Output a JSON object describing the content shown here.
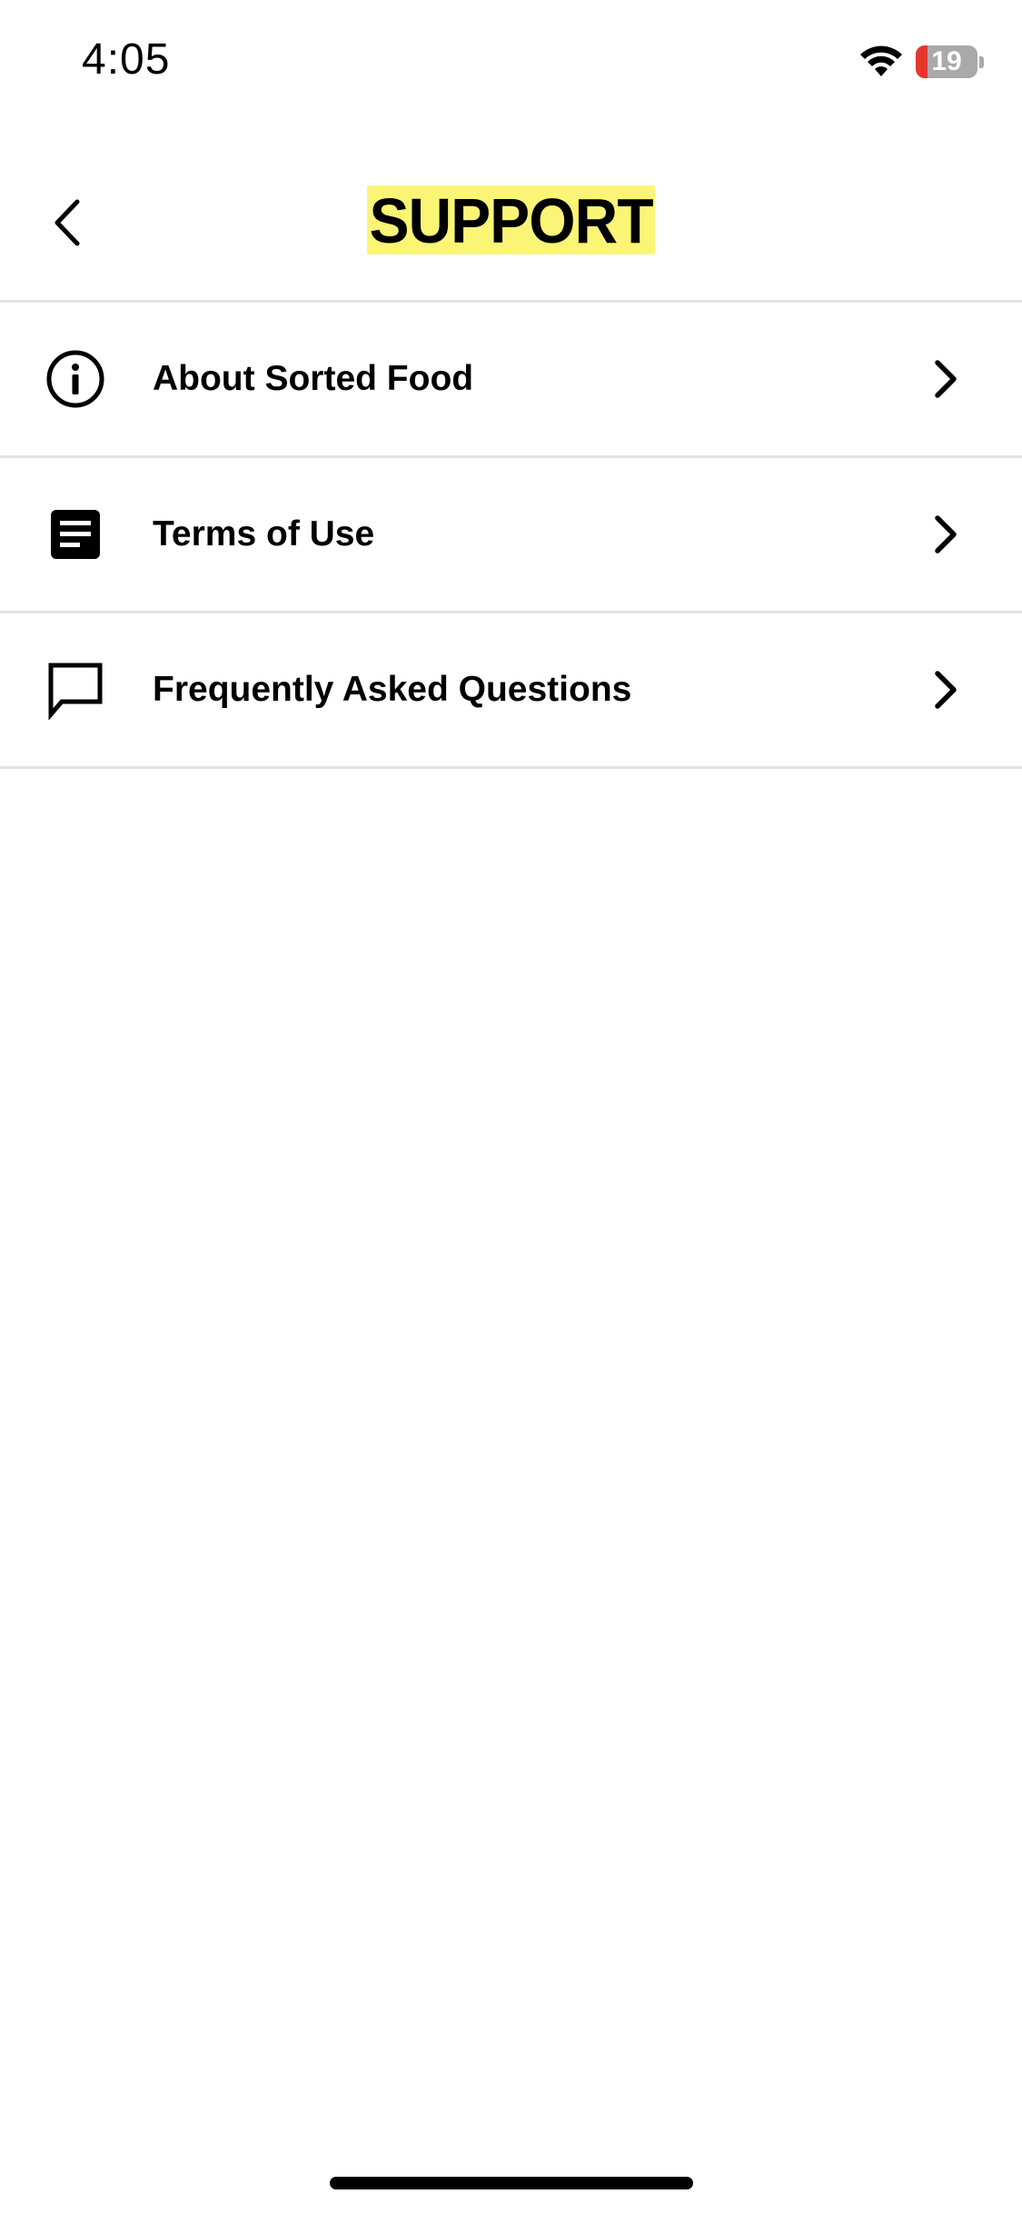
{
  "status_bar": {
    "time": "4:05",
    "battery_level": "19",
    "battery_fraction": 0.19,
    "wifi_icon": "wifi-icon",
    "battery_color": "#e5372e"
  },
  "header": {
    "title": "SUPPORT",
    "back_icon": "chevron-left-icon",
    "title_highlight_color": "#fbf576"
  },
  "menu": {
    "items": [
      {
        "label": "About Sorted Food",
        "icon": "info-icon"
      },
      {
        "label": "Terms of Use",
        "icon": "document-icon"
      },
      {
        "label": "Frequently Asked Questions",
        "icon": "chat-bubble-icon"
      }
    ],
    "chevron_icon": "chevron-right-icon"
  }
}
